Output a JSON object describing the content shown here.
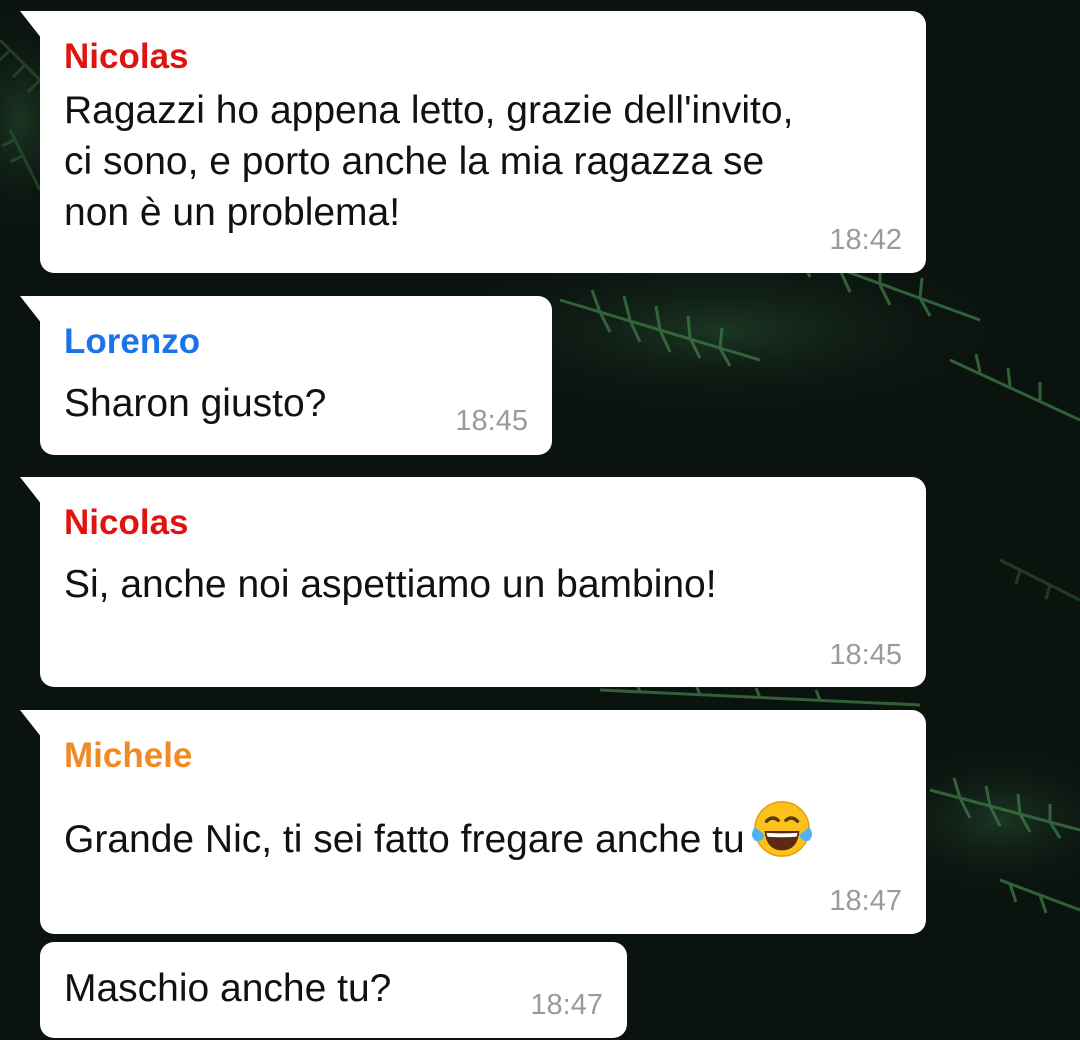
{
  "messages": [
    {
      "sender": "Nicolas",
      "sender_color": "#e0140f",
      "lines": [
        "Ragazzi ho appena letto, grazie dell'invito,",
        "ci sono, e porto anche la mia ragazza se",
        "non è un problema!"
      ],
      "time": "18:42"
    },
    {
      "sender": "Lorenzo",
      "sender_color": "#1a73e8",
      "lines": [
        "Sharon giusto?"
      ],
      "time": "18:45"
    },
    {
      "sender": "Nicolas",
      "sender_color": "#e0140f",
      "lines": [
        "Si, anche noi aspettiamo un bambino!"
      ],
      "time": "18:45"
    },
    {
      "sender": "Michele",
      "sender_color": "#f08a24",
      "lines": [
        "Grande Nic, ti sei fatto fregare anche tu"
      ],
      "emoji": "face-with-tears-of-joy",
      "time": "18:47"
    },
    {
      "lines": [
        "Maschio anche tu?"
      ],
      "time": "18:47"
    }
  ]
}
